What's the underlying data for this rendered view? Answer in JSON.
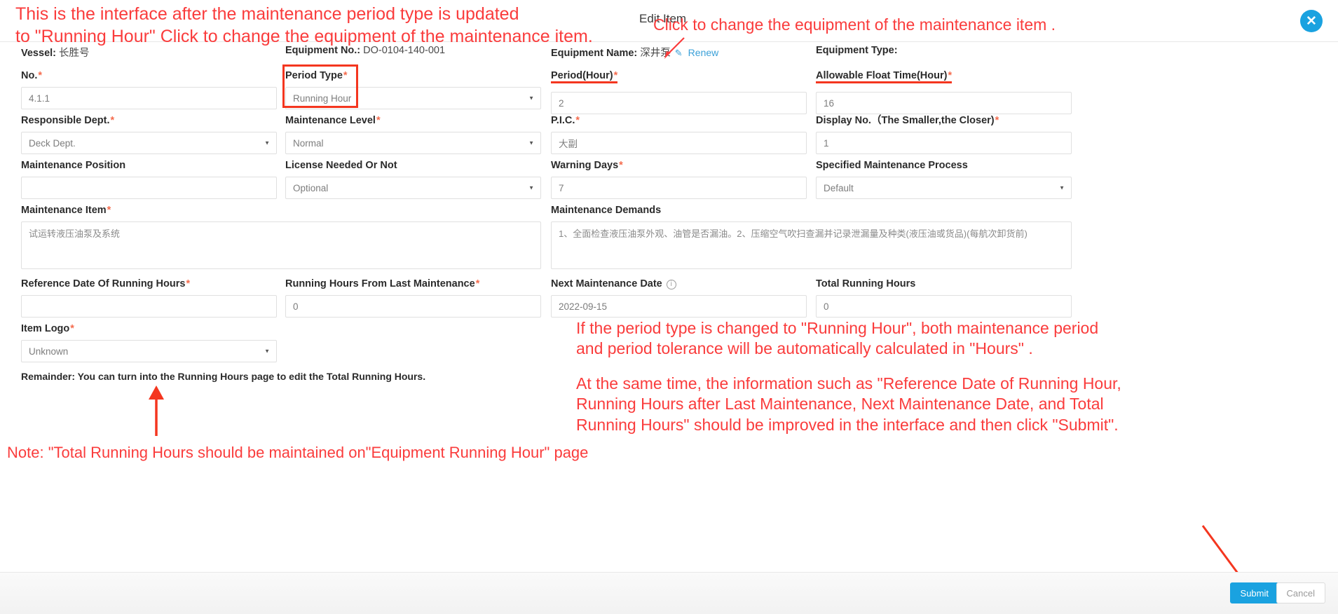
{
  "dialog": {
    "title": "Edit Item",
    "close_label": "✕"
  },
  "info": {
    "vessel_label": "Vessel:",
    "vessel_value": "长胜号",
    "equipment_no_label": "Equipment No.:",
    "equipment_no_value": "DO-0104-140-001",
    "equipment_name_label": "Equipment Name:",
    "equipment_name_value": "深井泵",
    "equipment_renew_link": "Renew",
    "equipment_type_label": "Equipment Type:",
    "equipment_type_value": ""
  },
  "fields": {
    "no": {
      "label": "No.",
      "required": true,
      "value": "4.1.1",
      "type": "text"
    },
    "period_type": {
      "label": "Period Type",
      "required": true,
      "value": "Running Hour",
      "type": "select"
    },
    "period_hour": {
      "label": "Period(Hour)",
      "required": true,
      "value": "2",
      "type": "text"
    },
    "allowable_float": {
      "label": "Allowable Float Time(Hour)",
      "required": true,
      "value": "16",
      "type": "text"
    },
    "responsible_dept": {
      "label": "Responsible Dept.",
      "required": true,
      "value": "Deck Dept.",
      "type": "select"
    },
    "maintenance_level": {
      "label": "Maintenance Level",
      "required": true,
      "value": "Normal",
      "type": "select"
    },
    "pic": {
      "label": "P.I.C.",
      "required": true,
      "value": "大副",
      "type": "text"
    },
    "display_no": {
      "label": "Display No.（The Smaller,the Closer)",
      "required": true,
      "value": "1",
      "type": "text"
    },
    "maintenance_position": {
      "label": "Maintenance Position",
      "required": false,
      "value": "",
      "type": "text"
    },
    "license_needed": {
      "label": "License Needed Or Not",
      "required": false,
      "value": "Optional",
      "type": "select"
    },
    "warning_days": {
      "label": "Warning Days",
      "required": true,
      "value": "7",
      "type": "text"
    },
    "specified_process": {
      "label": "Specified Maintenance Process",
      "required": false,
      "value": "Default",
      "type": "select"
    },
    "maintenance_item": {
      "label": "Maintenance Item",
      "required": true,
      "value": "试运转液压油泵及系统",
      "type": "textarea"
    },
    "maintenance_demands": {
      "label": "Maintenance Demands",
      "required": false,
      "value": "1、全面检查液压油泵外观、油管是否漏油。2、压缩空气吹扫查漏并记录泄漏量及种类(液压油或货品)(每航次卸货前)",
      "type": "textarea"
    },
    "reference_date": {
      "label": "Reference Date Of Running Hours",
      "required": true,
      "value": "",
      "type": "text"
    },
    "running_hours_last": {
      "label": "Running Hours From Last Maintenance",
      "required": true,
      "value": "0",
      "type": "text"
    },
    "next_maintenance_date": {
      "label": "Next Maintenance Date",
      "required": false,
      "value": "2022-09-15",
      "type": "text",
      "has_info_icon": true
    },
    "total_running_hours": {
      "label": "Total Running Hours",
      "required": false,
      "value": "0",
      "type": "text"
    },
    "item_logo": {
      "label": "Item Logo",
      "required": true,
      "value": "Unknown",
      "type": "select"
    }
  },
  "remainder": "Remainder: You can turn into the Running Hours page to edit the Total Running Hours.",
  "annotations": {
    "top_left": "This is the interface after the maintenance period type is updated\nto \"Running Hour\"  Click to change the equipment of the maintenance item.",
    "top_right": "Click to change the equipment of the maintenance item .",
    "mid_right": " If the period type is changed to \"Running Hour\", both maintenance period\nand  period tolerance will be  automatically calculated in \"Hours\" .",
    "bottom_right": "At the same time, the information such as \"Reference Date of Running Hour,\nRunning Hours after Last Maintenance, Next Maintenance Date, and Total\nRunning Hours\" should be improved in the interface and then click \"Submit\".",
    "bottom_left": "Note: \"Total Running Hours should be maintained on\"Equipment Running Hour\" page"
  },
  "footer": {
    "submit_label": "Submit",
    "cancel_label": "Cancel"
  },
  "colors": {
    "annotation_red": "#fa3c3c",
    "highlight_red": "#f4361f",
    "required_star": "#f56c4e",
    "primary_blue": "#1aa2e0",
    "link_blue": "#3aa0d8"
  }
}
